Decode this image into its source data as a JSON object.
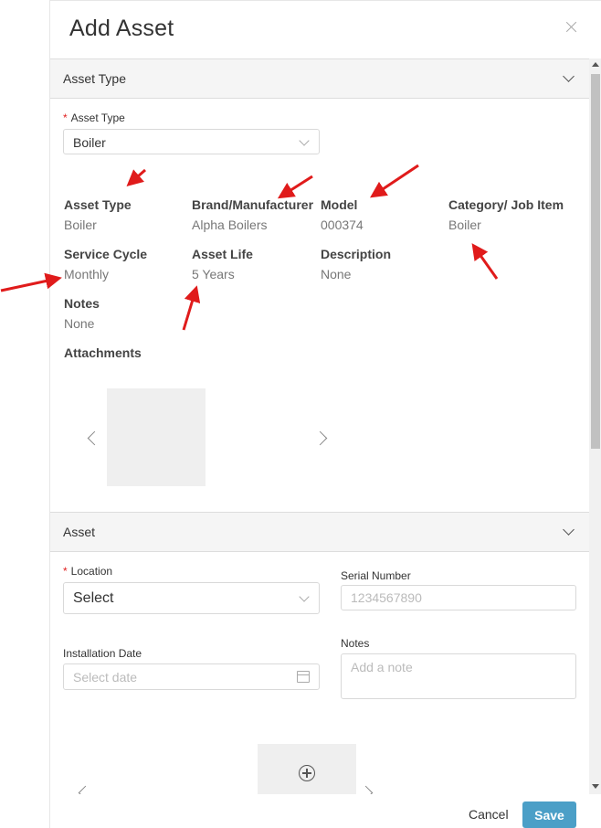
{
  "modal": {
    "title": "Add Asset",
    "close_icon": "close-icon"
  },
  "asset_type_section": {
    "header": "Asset Type",
    "type_field": {
      "label": "Asset Type",
      "required": true,
      "value": "Boiler"
    },
    "details": {
      "asset_type": {
        "label": "Asset Type",
        "value": "Boiler"
      },
      "brand": {
        "label": "Brand/Manufacturer",
        "value": "Alpha Boilers"
      },
      "model": {
        "label": "Model",
        "value": "000374"
      },
      "category": {
        "label": "Category/ Job Item",
        "value": "Boiler"
      },
      "service_cycle": {
        "label": "Service Cycle",
        "value": "Monthly"
      },
      "asset_life": {
        "label": "Asset Life",
        "value": "5 Years"
      },
      "description": {
        "label": "Description",
        "value": "None"
      },
      "notes": {
        "label": "Notes",
        "value": "None"
      },
      "attachments": {
        "label": "Attachments"
      }
    }
  },
  "asset_section": {
    "header": "Asset",
    "location": {
      "label": "Location",
      "required": true,
      "value": "Select"
    },
    "serial_number": {
      "label": "Serial Number",
      "placeholder": "1234567890"
    },
    "installation_date": {
      "label": "Installation Date",
      "placeholder": "Select date"
    },
    "notes": {
      "label": "Notes",
      "placeholder": "Add a note"
    }
  },
  "footer": {
    "cancel_label": "Cancel",
    "save_label": "Save"
  },
  "colors": {
    "primary_button": "#4b9fc7",
    "required_marker": "#e02020",
    "annotation_arrow": "#e01b1b"
  }
}
